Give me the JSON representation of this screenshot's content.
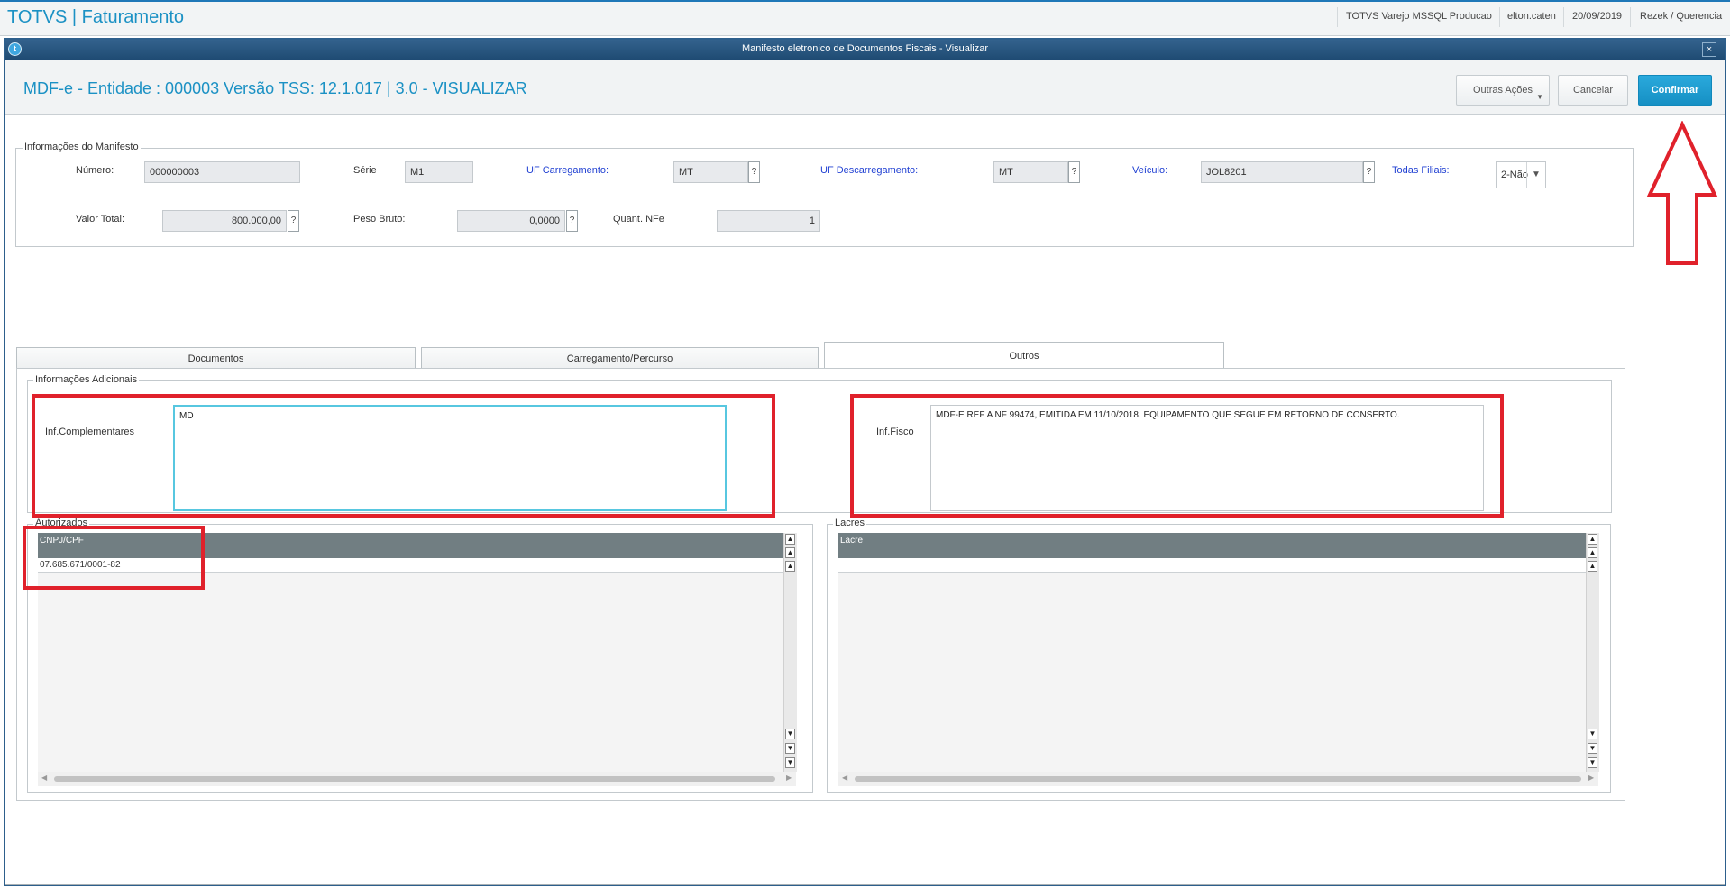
{
  "app": {
    "title": "TOTVS | Faturamento",
    "environment": "TOTVS Varejo MSSQL Producao",
    "user": "elton.caten",
    "date": "20/09/2019",
    "branch": "Rezek / Querencia"
  },
  "dialog": {
    "title": "Manifesto eletronico de Documentos Fiscais - Visualizar",
    "close_symbol": "×",
    "header_title": "MDF-e - Entidade : 000003 Versão TSS: 12.1.017 | 3.0 - VISUALIZAR",
    "buttons": {
      "outras": "Outras Ações",
      "cancelar": "Cancelar",
      "confirmar": "Confirmar"
    }
  },
  "manifesto": {
    "group_label": "Informações do Manifesto",
    "numero_label": "Número:",
    "numero": "000000003",
    "serie_label": "Série",
    "serie": "M1",
    "uf_carreg_label": "UF Carregamento:",
    "uf_carreg": "MT",
    "uf_descarreg_label": "UF Descarregamento:",
    "uf_descarreg": "MT",
    "veiculo_label": "Veículo:",
    "veiculo": "JOL8201",
    "todas_filiais_label": "Todas Filiais:",
    "todas_filiais": "2-Não",
    "valor_total_label": "Valor Total:",
    "valor_total": "800.000,00",
    "peso_bruto_label": "Peso Bruto:",
    "peso_bruto": "0,0000",
    "quant_nfe_label": "Quant. NFe",
    "quant_nfe": "1",
    "help_symbol": "?"
  },
  "tabs": [
    {
      "label": "Documentos",
      "active": false
    },
    {
      "label": "Carregamento/Percurso",
      "active": false
    },
    {
      "label": "Outros",
      "active": true
    }
  ],
  "outros": {
    "group_label": "Informações Adicionais",
    "inf_complementares_label": "Inf.Complementares",
    "inf_complementares": "MD",
    "inf_fisco_label": "Inf.Fisco",
    "inf_fisco": "MDF-E REF A NF 99474, EMITIDA EM 11/10/2018. EQUIPAMENTO QUE SEGUE EM RETORNO DE CONSERTO.",
    "autorizados": {
      "label": "Autorizados",
      "column": "CNPJ/CPF",
      "rows": [
        "07.685.671/0001-82"
      ]
    },
    "lacres": {
      "label": "Lacres",
      "column": "Lacre",
      "rows": [
        ""
      ]
    }
  },
  "colors": {
    "accent": "#1b91c4",
    "confirm": "#1a9bd0",
    "annotation": "#e0212b",
    "grid_header": "#717e82"
  }
}
